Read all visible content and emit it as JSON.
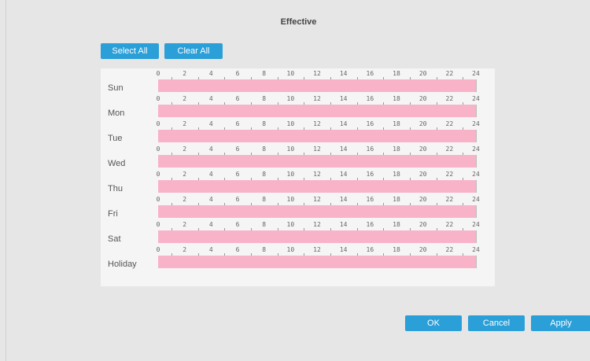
{
  "dialog": {
    "title": "Effective"
  },
  "toolbar": {
    "select_all_label": "Select All",
    "clear_all_label": "Clear All"
  },
  "schedule": {
    "hour_ticks": [
      "0",
      "2",
      "4",
      "6",
      "8",
      "10",
      "12",
      "14",
      "16",
      "18",
      "20",
      "22",
      "24"
    ],
    "days": [
      {
        "label": "Sun",
        "fill_fraction": 1.0
      },
      {
        "label": "Mon",
        "fill_fraction": 1.0
      },
      {
        "label": "Tue",
        "fill_fraction": 1.0
      },
      {
        "label": "Wed",
        "fill_fraction": 1.0
      },
      {
        "label": "Thu",
        "fill_fraction": 1.0
      },
      {
        "label": "Fri",
        "fill_fraction": 1.0
      },
      {
        "label": "Sat",
        "fill_fraction": 1.0
      },
      {
        "label": "Holiday",
        "fill_fraction": 1.0
      }
    ],
    "bar_color": "#f8b3c9"
  },
  "footer": {
    "ok_label": "OK",
    "cancel_label": "Cancel",
    "apply_label": "Apply"
  },
  "colors": {
    "accent": "#2a9fd8",
    "background": "#e6e6e6",
    "panel": "#f5f5f5"
  }
}
